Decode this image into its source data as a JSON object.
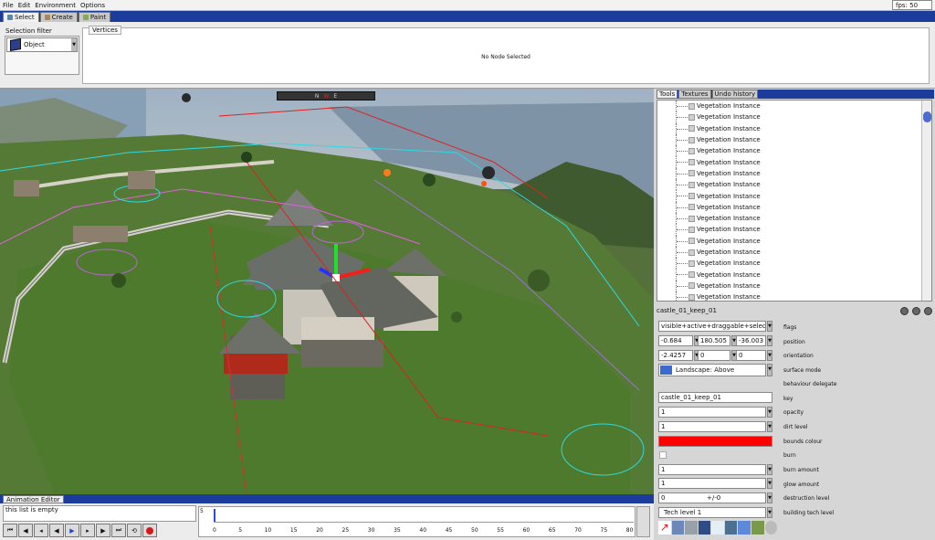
{
  "menu": [
    "File",
    "Edit",
    "Environment",
    "Options"
  ],
  "fps": "fps: 50",
  "tabs": [
    {
      "label": "Select",
      "active": true
    },
    {
      "label": "Create",
      "active": false
    },
    {
      "label": "Paint",
      "active": false
    }
  ],
  "top_panel": {
    "selection_filter_label": "Selection filter",
    "selection_filter_value": "Object",
    "vertices_tab": "Vertices",
    "no_node": "No Node Selected"
  },
  "viewport": {
    "toolbar": [
      "N",
      "W",
      "E"
    ]
  },
  "right_panel": {
    "tabs": [
      "Tools",
      "Textures",
      "Undo history"
    ],
    "tree_items": [
      "Vegetation Instance",
      "Vegetation Instance",
      "Vegetation Instance",
      "Vegetation Instance",
      "Vegetation Instance",
      "Vegetation Instance",
      "Vegetation Instance",
      "Vegetation Instance",
      "Vegetation Instance",
      "Vegetation Instance",
      "Vegetation Instance",
      "Vegetation Instance",
      "Vegetation Instance",
      "Vegetation Instance",
      "Vegetation Instance",
      "Vegetation Instance",
      "Vegetation Instance",
      "Vegetation Instance"
    ],
    "node_name": "castle_01_keep_01",
    "flags": "visible+active+draggable+selectable+",
    "position": [
      "-0.684",
      "180.505",
      "-36.003"
    ],
    "orientation": [
      "-2.4257",
      "0",
      "0"
    ],
    "surface_mode": "Landscape: Above",
    "key": "castle_01_keep_01",
    "opacity": "1",
    "dirt_level": "1",
    "burn_amount": "1",
    "glow_amount": "1",
    "destruction_level": "0",
    "destruction_text": "+/-0",
    "building_tech_level": "Tech level 1",
    "bounds_colour": "#ff0000",
    "labels": {
      "flags": "flags",
      "position": "position",
      "orientation": "orientation",
      "surface_mode": "surface mode",
      "behaviour_delegate": "behaviour delegate",
      "key": "key",
      "opacity": "opacity",
      "dirt_level": "dirt level",
      "bounds_colour": "bounds colour",
      "burn": "burn",
      "burn_amount": "burn amount",
      "glow_amount": "glow amount",
      "destruction_level": "destruction level",
      "building_tech_level": "building tech level"
    }
  },
  "animation": {
    "tab": "Animation Editor",
    "list_text": "this list is empty",
    "row_label": "5",
    "ticks": [
      "0",
      "5",
      "10",
      "15",
      "20",
      "25",
      "30",
      "35",
      "40",
      "45",
      "50",
      "55",
      "60",
      "65",
      "70",
      "75",
      "80"
    ]
  }
}
